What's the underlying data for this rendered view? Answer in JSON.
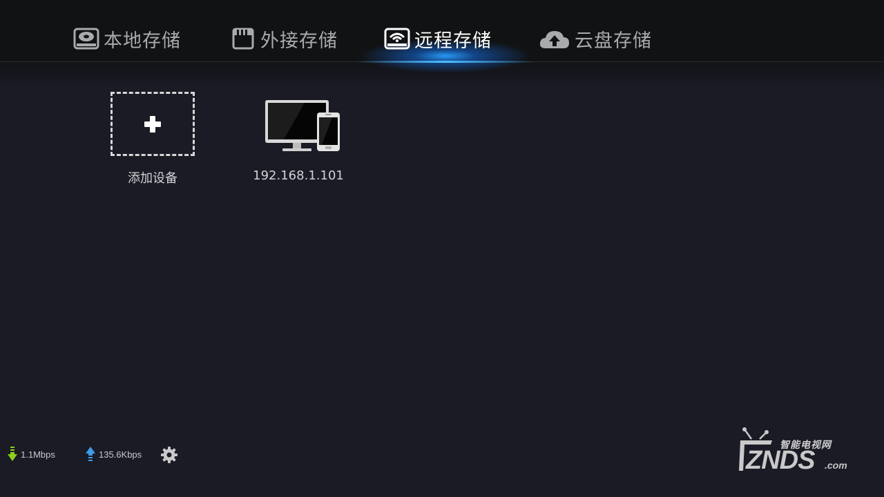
{
  "tabs": [
    {
      "id": "local",
      "label": "本地存储",
      "icon": "hard-disk-icon",
      "active": false
    },
    {
      "id": "external",
      "label": "外接存储",
      "icon": "sd-card-icon",
      "active": false
    },
    {
      "id": "remote",
      "label": "远程存储",
      "icon": "network-drive-icon",
      "active": true
    },
    {
      "id": "cloud",
      "label": "云盘存储",
      "icon": "cloud-upload-icon",
      "active": false
    }
  ],
  "devices": {
    "add_label": "添加设备",
    "items": [
      {
        "label": "192.168.1.101",
        "icon": "pc-phone-icon"
      }
    ]
  },
  "status": {
    "download_speed": "1.1Mbps",
    "upload_speed": "135.6Kbps"
  },
  "watermark": {
    "cn": "智能电视网",
    "en": "ZNDS",
    "suffix": ".com"
  },
  "colors": {
    "background": "#1a1b25",
    "topbar": "#111213",
    "accent_glow": "#28a0ff",
    "download_arrow": "#8bd11e",
    "upload_arrow": "#3f9be8"
  }
}
